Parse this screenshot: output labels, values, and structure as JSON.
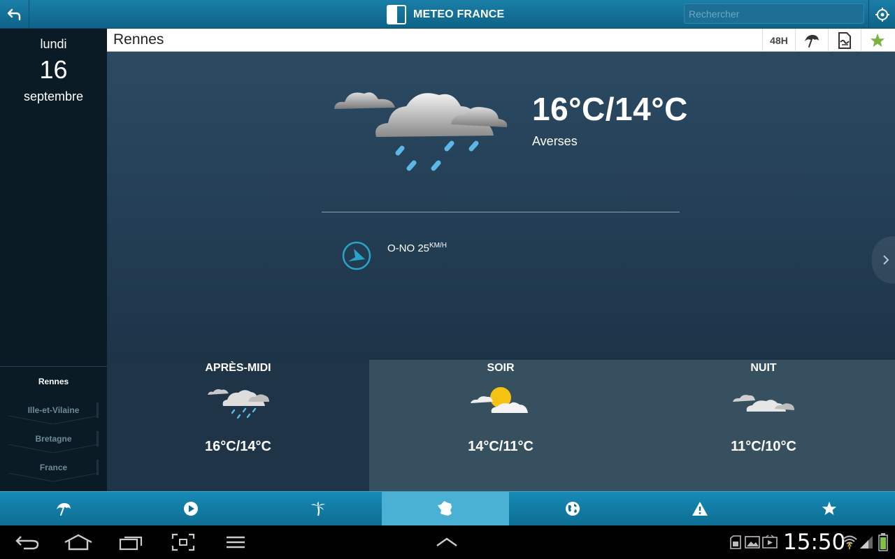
{
  "app": {
    "brand": "METEO FRANCE"
  },
  "search": {
    "placeholder": "Rechercher"
  },
  "date": {
    "weekday": "lundi",
    "day": "16",
    "month": "septembre"
  },
  "locations": [
    {
      "label": "Rennes",
      "active": true
    },
    {
      "label": "Ille-et-Vilaine",
      "active": false
    },
    {
      "label": "Bretagne",
      "active": false
    },
    {
      "label": "France",
      "active": false
    }
  ],
  "header": {
    "city": "Rennes",
    "h48_label": "48H"
  },
  "current": {
    "temperature": "16°C/14°C",
    "description": "Averses",
    "wind_text": "O-NO 25",
    "wind_unit": "KM/H"
  },
  "periods": [
    {
      "title": "APRÈS-MIDI",
      "temp": "16°C/14°C",
      "icon": "rain-cloud-icon"
    },
    {
      "title": "SOIR",
      "temp": "14°C/11°C",
      "icon": "sun-cloud-icon"
    },
    {
      "title": "NUIT",
      "temp": "11°C/10°C",
      "icon": "clouds-icon"
    }
  ],
  "bottom_nav": [
    {
      "icon": "umbrella-icon",
      "active": false
    },
    {
      "icon": "play-icon",
      "active": false
    },
    {
      "icon": "palm-tree-icon",
      "active": false
    },
    {
      "icon": "france-map-icon",
      "active": true
    },
    {
      "icon": "globe-icon",
      "active": false
    },
    {
      "icon": "warning-icon",
      "active": false
    },
    {
      "icon": "star-icon",
      "active": false
    }
  ],
  "system": {
    "clock": "15:50"
  },
  "colors": {
    "accent": "#1686b2",
    "favorite": "#7cb342",
    "wind": "#2aa3c9"
  }
}
